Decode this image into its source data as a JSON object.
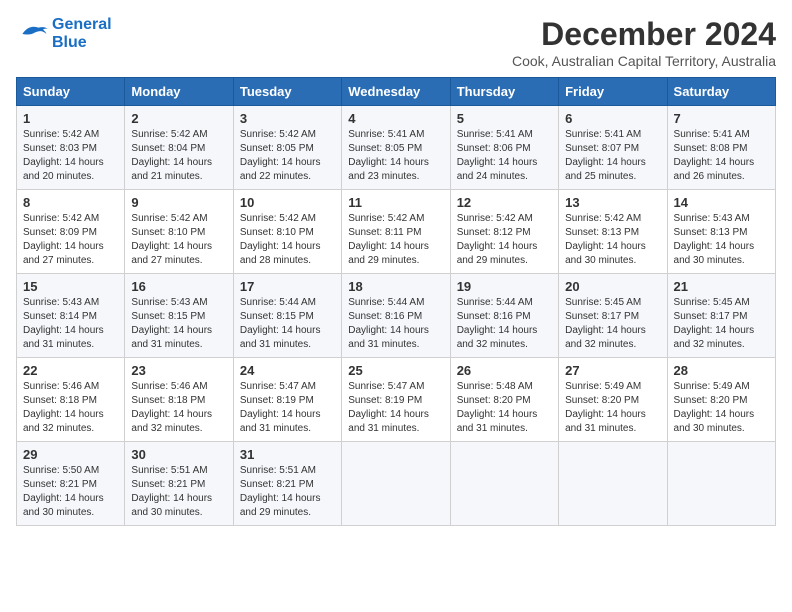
{
  "logo": {
    "line1": "General",
    "line2": "Blue"
  },
  "title": "December 2024",
  "subtitle": "Cook, Australian Capital Territory, Australia",
  "days_of_week": [
    "Sunday",
    "Monday",
    "Tuesday",
    "Wednesday",
    "Thursday",
    "Friday",
    "Saturday"
  ],
  "weeks": [
    [
      {
        "day": "1",
        "info": "Sunrise: 5:42 AM\nSunset: 8:03 PM\nDaylight: 14 hours\nand 20 minutes."
      },
      {
        "day": "2",
        "info": "Sunrise: 5:42 AM\nSunset: 8:04 PM\nDaylight: 14 hours\nand 21 minutes."
      },
      {
        "day": "3",
        "info": "Sunrise: 5:42 AM\nSunset: 8:05 PM\nDaylight: 14 hours\nand 22 minutes."
      },
      {
        "day": "4",
        "info": "Sunrise: 5:41 AM\nSunset: 8:05 PM\nDaylight: 14 hours\nand 23 minutes."
      },
      {
        "day": "5",
        "info": "Sunrise: 5:41 AM\nSunset: 8:06 PM\nDaylight: 14 hours\nand 24 minutes."
      },
      {
        "day": "6",
        "info": "Sunrise: 5:41 AM\nSunset: 8:07 PM\nDaylight: 14 hours\nand 25 minutes."
      },
      {
        "day": "7",
        "info": "Sunrise: 5:41 AM\nSunset: 8:08 PM\nDaylight: 14 hours\nand 26 minutes."
      }
    ],
    [
      {
        "day": "8",
        "info": "Sunrise: 5:42 AM\nSunset: 8:09 PM\nDaylight: 14 hours\nand 27 minutes."
      },
      {
        "day": "9",
        "info": "Sunrise: 5:42 AM\nSunset: 8:10 PM\nDaylight: 14 hours\nand 27 minutes."
      },
      {
        "day": "10",
        "info": "Sunrise: 5:42 AM\nSunset: 8:10 PM\nDaylight: 14 hours\nand 28 minutes."
      },
      {
        "day": "11",
        "info": "Sunrise: 5:42 AM\nSunset: 8:11 PM\nDaylight: 14 hours\nand 29 minutes."
      },
      {
        "day": "12",
        "info": "Sunrise: 5:42 AM\nSunset: 8:12 PM\nDaylight: 14 hours\nand 29 minutes."
      },
      {
        "day": "13",
        "info": "Sunrise: 5:42 AM\nSunset: 8:13 PM\nDaylight: 14 hours\nand 30 minutes."
      },
      {
        "day": "14",
        "info": "Sunrise: 5:43 AM\nSunset: 8:13 PM\nDaylight: 14 hours\nand 30 minutes."
      }
    ],
    [
      {
        "day": "15",
        "info": "Sunrise: 5:43 AM\nSunset: 8:14 PM\nDaylight: 14 hours\nand 31 minutes."
      },
      {
        "day": "16",
        "info": "Sunrise: 5:43 AM\nSunset: 8:15 PM\nDaylight: 14 hours\nand 31 minutes."
      },
      {
        "day": "17",
        "info": "Sunrise: 5:44 AM\nSunset: 8:15 PM\nDaylight: 14 hours\nand 31 minutes."
      },
      {
        "day": "18",
        "info": "Sunrise: 5:44 AM\nSunset: 8:16 PM\nDaylight: 14 hours\nand 31 minutes."
      },
      {
        "day": "19",
        "info": "Sunrise: 5:44 AM\nSunset: 8:16 PM\nDaylight: 14 hours\nand 32 minutes."
      },
      {
        "day": "20",
        "info": "Sunrise: 5:45 AM\nSunset: 8:17 PM\nDaylight: 14 hours\nand 32 minutes."
      },
      {
        "day": "21",
        "info": "Sunrise: 5:45 AM\nSunset: 8:17 PM\nDaylight: 14 hours\nand 32 minutes."
      }
    ],
    [
      {
        "day": "22",
        "info": "Sunrise: 5:46 AM\nSunset: 8:18 PM\nDaylight: 14 hours\nand 32 minutes."
      },
      {
        "day": "23",
        "info": "Sunrise: 5:46 AM\nSunset: 8:18 PM\nDaylight: 14 hours\nand 32 minutes."
      },
      {
        "day": "24",
        "info": "Sunrise: 5:47 AM\nSunset: 8:19 PM\nDaylight: 14 hours\nand 31 minutes."
      },
      {
        "day": "25",
        "info": "Sunrise: 5:47 AM\nSunset: 8:19 PM\nDaylight: 14 hours\nand 31 minutes."
      },
      {
        "day": "26",
        "info": "Sunrise: 5:48 AM\nSunset: 8:20 PM\nDaylight: 14 hours\nand 31 minutes."
      },
      {
        "day": "27",
        "info": "Sunrise: 5:49 AM\nSunset: 8:20 PM\nDaylight: 14 hours\nand 31 minutes."
      },
      {
        "day": "28",
        "info": "Sunrise: 5:49 AM\nSunset: 8:20 PM\nDaylight: 14 hours\nand 30 minutes."
      }
    ],
    [
      {
        "day": "29",
        "info": "Sunrise: 5:50 AM\nSunset: 8:21 PM\nDaylight: 14 hours\nand 30 minutes."
      },
      {
        "day": "30",
        "info": "Sunrise: 5:51 AM\nSunset: 8:21 PM\nDaylight: 14 hours\nand 30 minutes."
      },
      {
        "day": "31",
        "info": "Sunrise: 5:51 AM\nSunset: 8:21 PM\nDaylight: 14 hours\nand 29 minutes."
      },
      {
        "day": "",
        "info": ""
      },
      {
        "day": "",
        "info": ""
      },
      {
        "day": "",
        "info": ""
      },
      {
        "day": "",
        "info": ""
      }
    ]
  ]
}
